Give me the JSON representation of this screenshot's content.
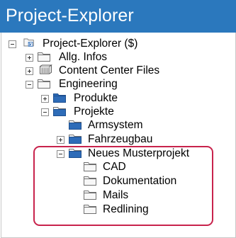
{
  "panel": {
    "title": "Project-Explorer"
  },
  "tree": {
    "root": {
      "label": "Project-Explorer ($)",
      "icon": "project-root-icon",
      "toggle": "collapse"
    },
    "allg_infos": {
      "label": "Allg. Infos",
      "icon": "folder-icon",
      "toggle": "expand"
    },
    "content_center": {
      "label": "Content Center Files",
      "icon": "content-center-icon",
      "toggle": "expand"
    },
    "engineering": {
      "label": "Engineering",
      "icon": "folder-icon",
      "toggle": "collapse"
    },
    "produkte": {
      "label": "Produkte",
      "icon": "folder-blue-icon",
      "toggle": "expand"
    },
    "projekte": {
      "label": "Projekte",
      "icon": "folder-blue-icon",
      "toggle": "collapse"
    },
    "armsystem": {
      "label": "Armsystem",
      "icon": "folder-blue-icon"
    },
    "fahrzeugbau": {
      "label": "Fahrzeugbau",
      "icon": "folder-blue-icon",
      "toggle": "expand"
    },
    "neues_musterprojekt": {
      "label": "Neues Musterprojekt",
      "icon": "folder-blue-icon",
      "toggle": "collapse"
    },
    "cad": {
      "label": "CAD",
      "icon": "folder-icon"
    },
    "dokumentation": {
      "label": "Dokumentation",
      "icon": "folder-icon"
    },
    "mails": {
      "label": "Mails",
      "icon": "folder-icon"
    },
    "redlining": {
      "label": "Redlining",
      "icon": "folder-icon"
    }
  },
  "colors": {
    "header_bg": "#2b78bd",
    "header_text": "#ffffff",
    "folder_outline": "#707070",
    "folder_fill": "#f7f7f7",
    "folder_blue": "#2e6cb8",
    "highlight": "#c8234c"
  }
}
